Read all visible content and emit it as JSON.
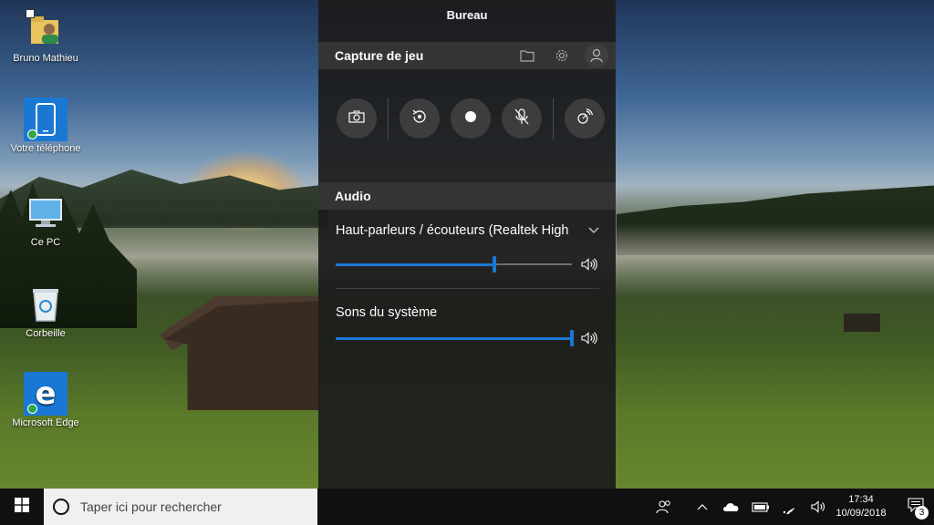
{
  "desktop": {
    "icons": [
      {
        "label": "Bruno Mathieu",
        "icon": "user-folder-icon"
      },
      {
        "label": "Votre téléphone",
        "icon": "phone-icon"
      },
      {
        "label": "Ce PC",
        "icon": "computer-icon"
      },
      {
        "label": "Corbeille",
        "icon": "recycle-bin-icon"
      },
      {
        "label": "Microsoft Edge",
        "icon": "edge-icon"
      }
    ]
  },
  "game_bar": {
    "title": "Bureau",
    "capture": {
      "header": "Capture de jeu",
      "header_icons": [
        "folder-icon",
        "gear-icon",
        "user-icon"
      ],
      "buttons": [
        "camera-icon",
        "replay-icon",
        "record-icon",
        "mic-off-icon",
        "broadcast-icon"
      ]
    },
    "audio": {
      "header": "Audio",
      "device_name": "Haut-parleurs / écouteurs (Realtek High",
      "device_volume": 0.67,
      "system_label": "Sons du système",
      "system_volume": 1.0
    }
  },
  "taskbar": {
    "search_placeholder": "Taper ici pour rechercher",
    "time": "17:34",
    "date": "10/09/2018",
    "notification_count": "3",
    "tray_icons": [
      "people-icon",
      "chevron-up-icon",
      "onedrive-icon",
      "battery-icon",
      "wifi-icon",
      "volume-icon"
    ]
  },
  "colors": {
    "accent": "#1a78d4",
    "panel_bg": "#1c1c1c",
    "section_bg": "#343434"
  }
}
